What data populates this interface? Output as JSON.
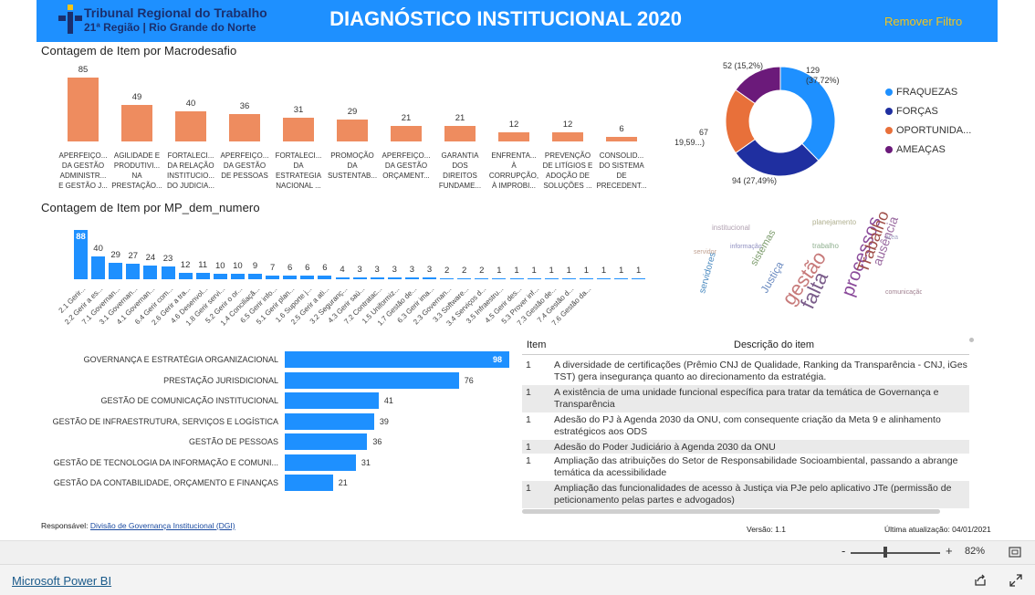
{
  "header": {
    "org_line1": "Tribunal Regional do Trabalho",
    "org_line2": "21ª Região | Rio Grande do Norte",
    "title": "DIAGNÓSTICO INSTITUCIONAL 2020",
    "remove_filter": "Remover Filtro"
  },
  "section1_title": "Contagem de Item por Macrodesafio",
  "section2_title": "Contagem de Item por MP_dem_numero",
  "colors": {
    "orange": "#ee8c5f",
    "blue": "#1e90ff",
    "navy": "#1f2fa0",
    "purple": "#6b1a7a",
    "header": "#1e90ff"
  },
  "chart_data": [
    {
      "type": "bar",
      "title": "Contagem de Item por Macrodesafio",
      "categories": [
        "APERFEIÇO... DA GESTÃO ADMINISTR... E GESTÃO J...",
        "AGILIDADE E PRODUTIVI... NA PRESTAÇÃO...",
        "FORTALECI... DA RELAÇÃO INSTITUCIO... DO JUDICIA...",
        "APERFEIÇO... DA GESTÃO DE PESSOAS",
        "FORTALECI... DA ESTRATEGIA NACIONAL ...",
        "PROMOÇÃO DA SUSTENTAB...",
        "APERFEIÇO... DA GESTÃO ORÇAMENT...",
        "GARANTIA DOS DIREITOS FUNDAME...",
        "ENFRENTA... À CORRUPÇÃO, À IMPROBI...",
        "PREVENÇÃO DE LITÍGIOS E ADOÇÃO DE SOLUÇÕES ...",
        "CONSOLID... DO SISTEMA DE PRECEDENT..."
      ],
      "values": [
        85,
        49,
        40,
        36,
        31,
        29,
        21,
        21,
        12,
        12,
        6
      ]
    },
    {
      "type": "pie",
      "slices": [
        {
          "name": "FRAQUEZAS",
          "value": 129,
          "label": "129 (37,72%)",
          "color": "#1e90ff"
        },
        {
          "name": "FORÇAS",
          "value": 94,
          "label": "94 (27,49%)",
          "color": "#1f2fa0"
        },
        {
          "name": "OPORTUNIDA...",
          "value": 67,
          "label": "67 (19,59...)",
          "color": "#e8703a"
        },
        {
          "name": "AMEAÇAS",
          "value": 52,
          "label": "52 (15,2%)",
          "color": "#6b1a7a"
        }
      ]
    },
    {
      "type": "bar",
      "title": "Contagem de Item por MP_dem_numero",
      "categories": [
        "2.1 Gerir...",
        "2.2 Gerir a es...",
        "7.1 Governan...",
        "3.1 Governan...",
        "4.1 Governan...",
        "6.4 Gerir com...",
        "2.6 Gerir a tra...",
        "4.6 Desenvol...",
        "1.8 Gerir servi...",
        "5.2 Gerir o or...",
        "1.4 Conciliaçã...",
        "6.5 Gerir info...",
        "5.1 Gerir plan...",
        "1.6 Suporte j...",
        "2.5 Gerir a ati...",
        "3.2 Seguranç...",
        "4.3 Gerir saú...",
        "7.2 Contratac...",
        "1.5 Uniformiz...",
        "1.7 Gestão de...",
        "6.3 Gerir ima...",
        "2.3 Governan...",
        "3.3 Software...",
        "3.4 Serviços d...",
        "3.5 Infraestru...",
        "4.5 Gerir des...",
        "5.3 Prover inf...",
        "7.3 Gestão de...",
        "7.4 Gestão d...",
        "7.6 Gestão da..."
      ],
      "values": [
        88,
        40,
        29,
        27,
        24,
        23,
        12,
        11,
        10,
        10,
        9,
        7,
        6,
        6,
        6,
        4,
        3,
        3,
        3,
        3,
        3,
        2,
        2,
        2,
        1,
        1,
        1,
        1,
        1,
        1,
        1,
        1,
        1
      ]
    },
    {
      "type": "bar",
      "orientation": "horizontal",
      "categories": [
        "GOVERNANÇA E ESTRATÉGIA ORGANIZACIONAL",
        "PRESTAÇÃO JURISDICIONAL",
        "GESTÃO DE COMUNICAÇÃO INSTITUCIONAL",
        "GESTÃO DE INFRAESTRUTURA, SERVIÇOS E LOGÍSTICA",
        "GESTÃO DE PESSOAS",
        "GESTÃO DE TECNOLOGIA DA INFORMAÇÃO E COMUNI...",
        "GESTÃO DA CONTABILIDADE, ORÇAMENTO E FINANÇAS"
      ],
      "values": [
        98,
        76,
        41,
        39,
        36,
        31,
        21
      ]
    }
  ],
  "wordcloud": {
    "big_words": [
      "gestão",
      "falta",
      "processos",
      "Trabalho",
      "Justiça",
      "ausência",
      "servidores",
      "sistemas"
    ]
  },
  "table": {
    "col_item": "Item",
    "col_desc": "Descrição do item",
    "rows": [
      {
        "item": "1",
        "desc": "A diversidade de certificações (Prêmio CNJ de Qualidade, Ranking da Transparência - CNJ, iGes TST) gera insegurança quanto ao direcionamento da estratégia."
      },
      {
        "item": "1",
        "desc": "A existência de uma unidade funcional específica para tratar da temática de Governança e Transparência"
      },
      {
        "item": "1",
        "desc": "Adesão do PJ à Agenda 2030 da ONU, com consequente criação da Meta 9 e alinhamento estratégicos aos ODS"
      },
      {
        "item": "1",
        "desc": "Adesão do Poder Judiciário à Agenda 2030 da ONU"
      },
      {
        "item": "1",
        "desc": "Ampliação das atribuições do Setor de Responsabilidade Socioambiental, passando a abrange temática da acessibilidade"
      },
      {
        "item": "1",
        "desc": "Ampliação das funcionalidades de acesso à Justiça via PJe pelo aplicativo JTe (permissão de peticionamento pelas partes e advogados)"
      }
    ]
  },
  "footer": {
    "responsavel_prefix": "Responsável: ",
    "responsavel_link": "Divisão de Governança Institucional (DGI)",
    "versao": "Versão: 1.1",
    "atualizacao": "Última atualização: 04/01/2021"
  },
  "viewer": {
    "zoom": "82%",
    "minus": "-",
    "plus": "+",
    "brand": "Microsoft Power BI"
  }
}
